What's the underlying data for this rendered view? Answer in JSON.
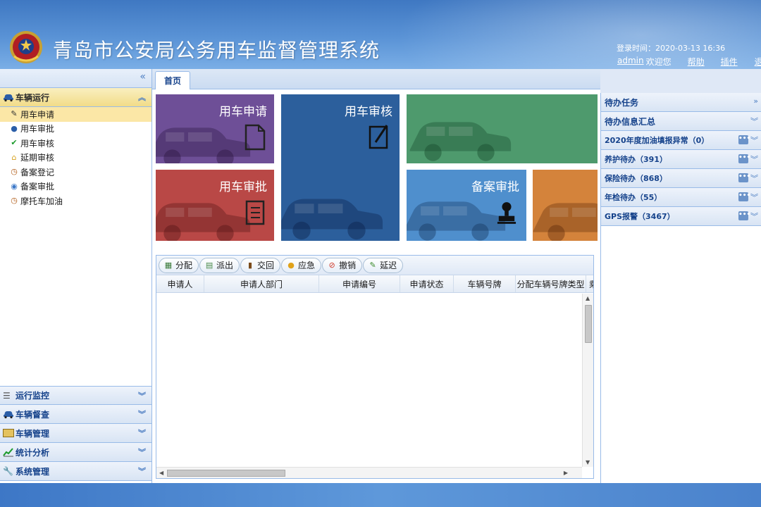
{
  "header": {
    "title": "青岛市公安局公务用车监督管理系统",
    "login_time": "登录时间：2020-03-13 16:36",
    "user": "admin",
    "welcome": "欢迎您",
    "help": "帮助",
    "plugin": "插件",
    "logout": "退出"
  },
  "sidebar": {
    "collapse_icon": "double-chevron-left",
    "open_section": "车辆运行",
    "items": [
      {
        "label": "用车申请",
        "icon": "edit-icon",
        "selected": true
      },
      {
        "label": "用车审批",
        "icon": "stamp-icon"
      },
      {
        "label": "用车审核",
        "icon": "check-icon"
      },
      {
        "label": "延期审核",
        "icon": "home-icon"
      },
      {
        "label": "备案登记",
        "icon": "clock-icon"
      },
      {
        "label": "备案审批",
        "icon": "globe-icon"
      },
      {
        "label": "摩托车加油",
        "icon": "clock-icon"
      }
    ],
    "sections": [
      {
        "label": "运行监控",
        "icon": "list-icon"
      },
      {
        "label": "车辆督查",
        "icon": "car-icon"
      },
      {
        "label": "车辆管理",
        "icon": "card-icon"
      },
      {
        "label": "统计分析",
        "icon": "chart-icon"
      },
      {
        "label": "系统管理",
        "icon": "wrench-icon"
      }
    ]
  },
  "tabs": [
    {
      "label": "首页",
      "active": true
    }
  ],
  "tiles": {
    "apply": {
      "label": "用车申请",
      "color": "#6e4f97"
    },
    "audit": {
      "label": "用车审核",
      "color": "#2c5f9c"
    },
    "green": {
      "label": "",
      "color": "#4e9a6d"
    },
    "approve": {
      "label": "用车审批",
      "color": "#b94846"
    },
    "record_approve": {
      "label": "备案审批",
      "color": "#4f8fcd"
    },
    "orange": {
      "label": "",
      "color": "#d4833b"
    }
  },
  "grid": {
    "toolbar": [
      {
        "label": "分配",
        "icon": "table-icon"
      },
      {
        "label": "派出",
        "icon": "dispatch-icon"
      },
      {
        "label": "交回",
        "icon": "book-icon"
      },
      {
        "label": "应急",
        "icon": "bulb-icon"
      },
      {
        "label": "撤销",
        "icon": "cancel-icon"
      },
      {
        "label": "延迟",
        "icon": "pencil-icon"
      }
    ],
    "columns": [
      "申请人",
      "申请人部门",
      "申请编号",
      "申请状态",
      "车辆号牌",
      "分配车辆号牌类型",
      "乘"
    ]
  },
  "right_panel": {
    "pending_tasks": "待办任务",
    "summary": "待办信息汇总",
    "items": [
      {
        "label": "2020年度加油填报异常（0）"
      },
      {
        "label": "养护待办（391）"
      },
      {
        "label": "保险待办（868）"
      },
      {
        "label": "年检待办（55）"
      },
      {
        "label": "GPS报警（3467）"
      }
    ]
  }
}
